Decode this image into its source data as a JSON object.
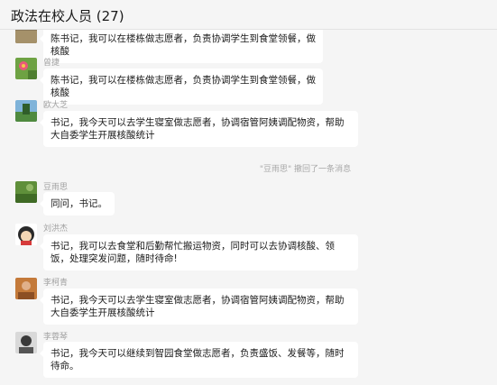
{
  "header": {
    "title": "政法在校人员 (27)"
  },
  "messages": [
    {
      "sender": "",
      "text": "陈书记，我可以在楼栋做志愿者，负责协调学生到食堂领餐，做核酸"
    },
    {
      "sender": "曾捷",
      "text": "陈书记，我可以在楼栋做志愿者，负责协调学生到食堂领餐，做核酸"
    },
    {
      "sender": "欧大芝",
      "text": "书记，我今天可以去学生寝室做志愿者，协调宿管阿姨调配物资，帮助大自委学生开展核酸统计"
    },
    {
      "sender": "豆雨思",
      "text": "同问，书记。"
    },
    {
      "sender": "刘洪杰",
      "text": "书记，我可以去食堂和后勤帮忙搬运物资，同时可以去协调核酸、领饭，处理突发问题，随时待命!"
    },
    {
      "sender": "李柯青",
      "text": "书记，我今天可以去学生寝室做志愿者，协调宿管阿姨调配物资，帮助大自委学生开展核酸统计"
    },
    {
      "sender": "李蓉琴",
      "text": "书记，我今天可以继续到智园食堂做志愿者，负责盛饭、发餐等，随时待命。"
    }
  ],
  "recall_notice": "\"豆雨思\" 撤回了一条消息"
}
